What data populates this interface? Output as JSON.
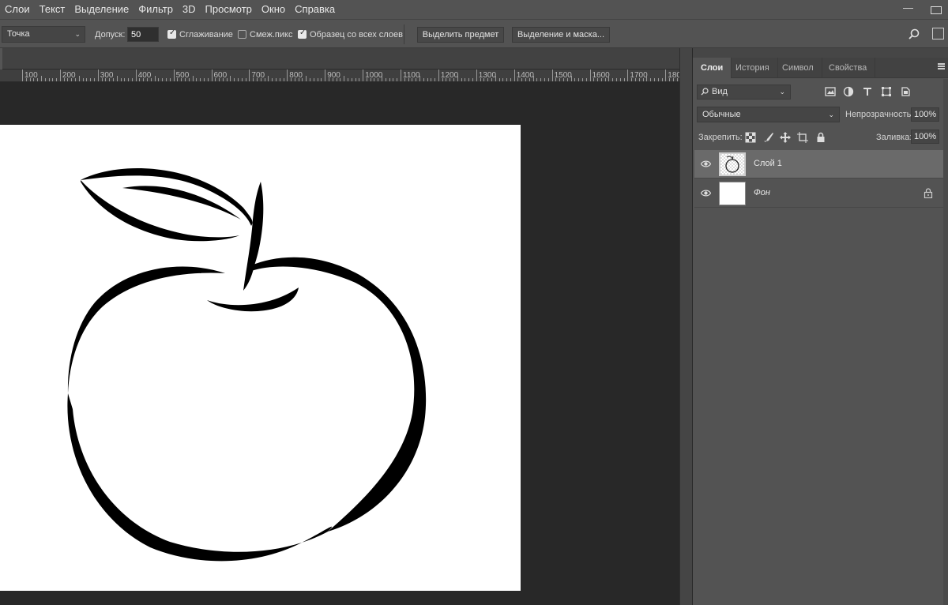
{
  "menu": [
    "Слои",
    "Текст",
    "Выделение",
    "Фильтр",
    "3D",
    "Просмотр",
    "Окно",
    "Справка"
  ],
  "options": {
    "sample_size": "Точка",
    "tolerance_label": "Допуск:",
    "tolerance_value": "50",
    "antialias_label": "Сглаживание",
    "antialias_checked": true,
    "contiguous_label": "Смеж.пикс",
    "contiguous_checked": false,
    "sample_all_label": "Образец со всех слоев",
    "sample_all_checked": true,
    "select_subject": "Выделить предмет",
    "select_mask": "Выделение и маска..."
  },
  "ruler": {
    "labels": [
      "100",
      "200",
      "300",
      "400",
      "500",
      "600",
      "700",
      "800",
      "900",
      "1000",
      "1100",
      "1200",
      "1300",
      "1400",
      "1500",
      "1600",
      "1700",
      "180"
    ]
  },
  "panel": {
    "tabs": [
      "Слои",
      "История",
      "Символ",
      "Свойства"
    ],
    "active_tab": "Слои",
    "filter": "Вид",
    "blend_mode": "Обычные",
    "opacity_label": "Непрозрачность:",
    "opacity_value": "100%",
    "lock_label": "Закрепить:",
    "fill_label": "Заливка:",
    "fill_value": "100%",
    "layers": [
      {
        "name": "Слой 1",
        "selected": true,
        "locked": false,
        "italic": false
      },
      {
        "name": "Фон",
        "selected": false,
        "locked": true,
        "italic": true
      }
    ]
  },
  "colors": {
    "menu_bg": "#535353",
    "canvas_bg": "#282828",
    "document": "#ffffff",
    "selected_layer": "#6a6a6a"
  }
}
